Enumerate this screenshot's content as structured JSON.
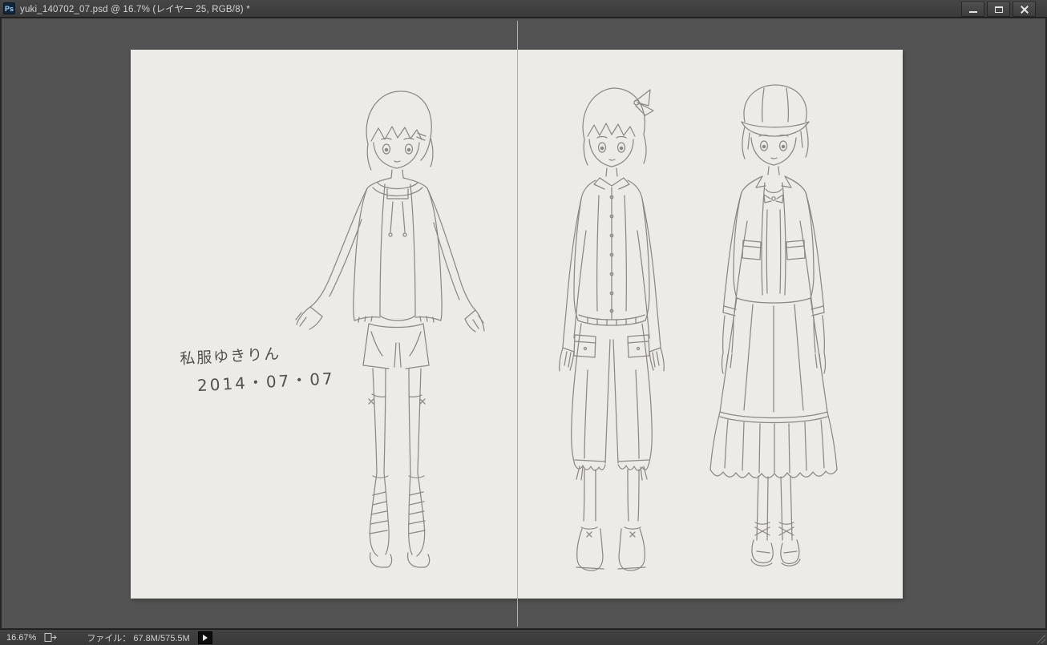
{
  "titlebar": {
    "app_icon": "Ps",
    "title": "yuki_140702_07.psd @ 16.7% (レイヤー 25, RGB/8) *",
    "controls": {
      "minimize": "minimize",
      "maximize": "maximize",
      "close": "close"
    }
  },
  "document": {
    "note": {
      "line1": "私服ゆきりん",
      "line2": "2014・07・07"
    },
    "figures": [
      "girl-in-hoodie-shorts-boots",
      "girl-in-buttoned-shirt-capri-pants",
      "girl-in-cap-jacket-long-ruffled-skirt"
    ],
    "guide": "vertical-cyan-guide"
  },
  "statusbar": {
    "zoom": "16.67%",
    "file_info": "ファイル： 67.8M/575.5M"
  },
  "colors": {
    "guide": "#29e3ee",
    "pasteboard": "#535353",
    "paper": "#edebe7",
    "chrome": "#3e3e3e",
    "sketch_line": "#8d8884"
  }
}
